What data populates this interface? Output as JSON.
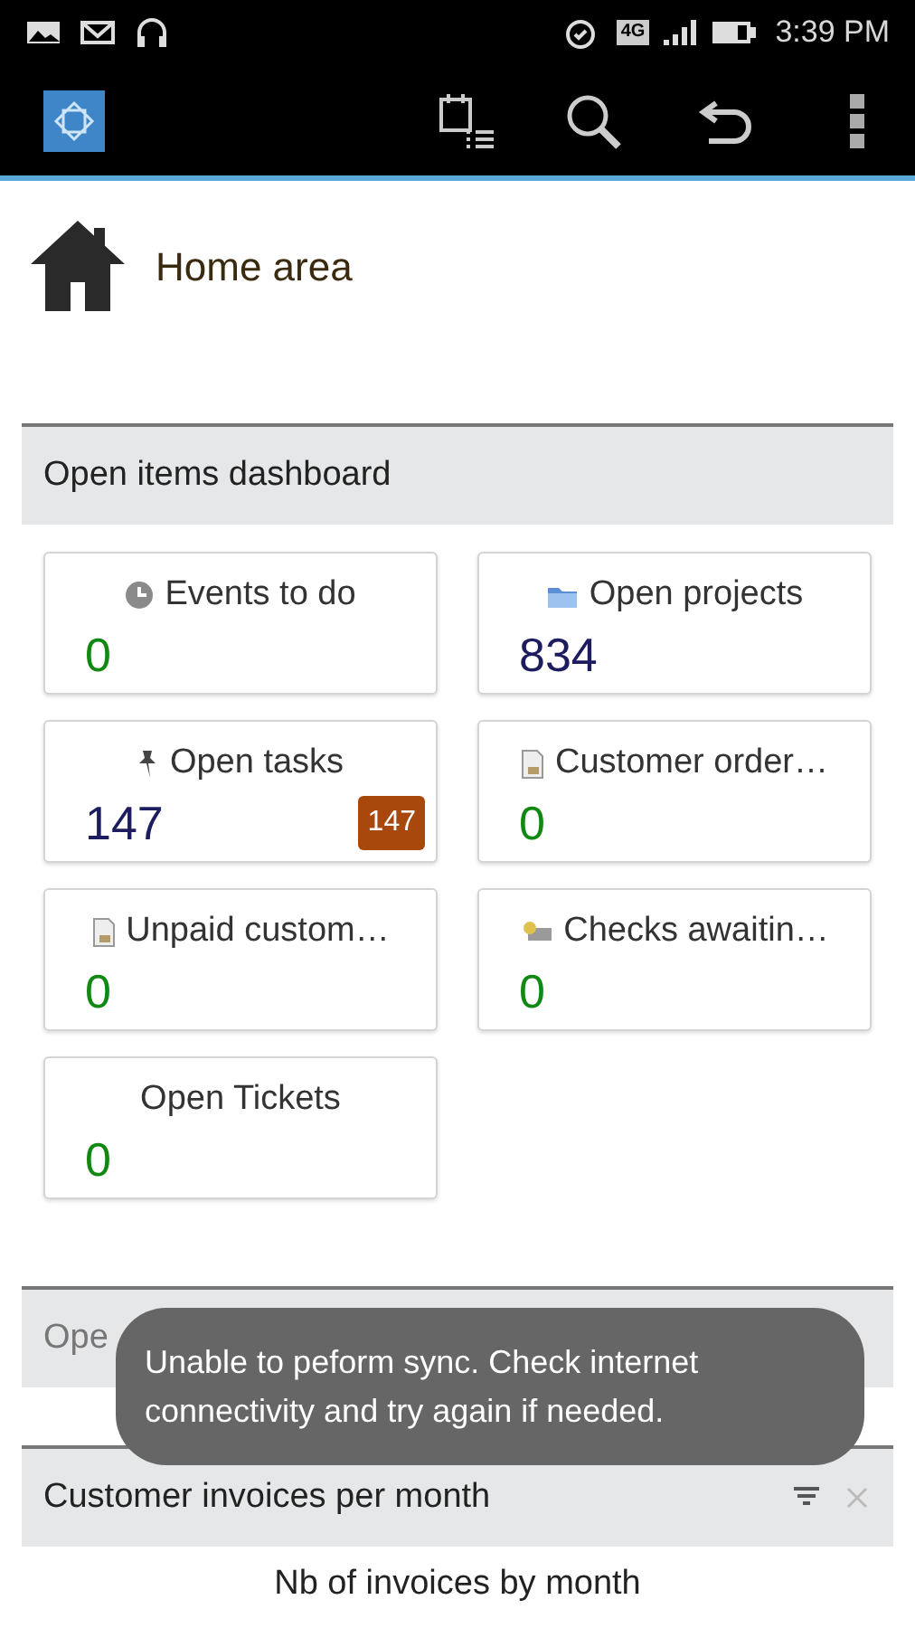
{
  "status_bar": {
    "network": "4G",
    "time": "3:39 PM"
  },
  "home": {
    "title": "Home area"
  },
  "dashboard": {
    "title": "Open items dashboard",
    "cards": [
      {
        "label": "Events to do",
        "value": "0",
        "color": "#118811"
      },
      {
        "label": "Open projects",
        "value": "834",
        "color": "#1c1c5e"
      },
      {
        "label": "Open tasks",
        "value": "147",
        "color": "#1c1c5e",
        "badge": "147"
      },
      {
        "label": "Customer order…",
        "value": "0",
        "color": "#118811"
      },
      {
        "label": "Unpaid custom…",
        "value": "0",
        "color": "#118811"
      },
      {
        "label": "Checks awaitin…",
        "value": "0",
        "color": "#118811"
      },
      {
        "label": "Open Tickets",
        "value": "0",
        "color": "#118811"
      }
    ]
  },
  "section_2": {
    "title": "Ope"
  },
  "invoices": {
    "title": "Customer invoices per month",
    "subtitle": "Nb of invoices by month"
  },
  "toast": {
    "message": "Unable to peform sync. Check internet connectivity and try again if needed."
  }
}
